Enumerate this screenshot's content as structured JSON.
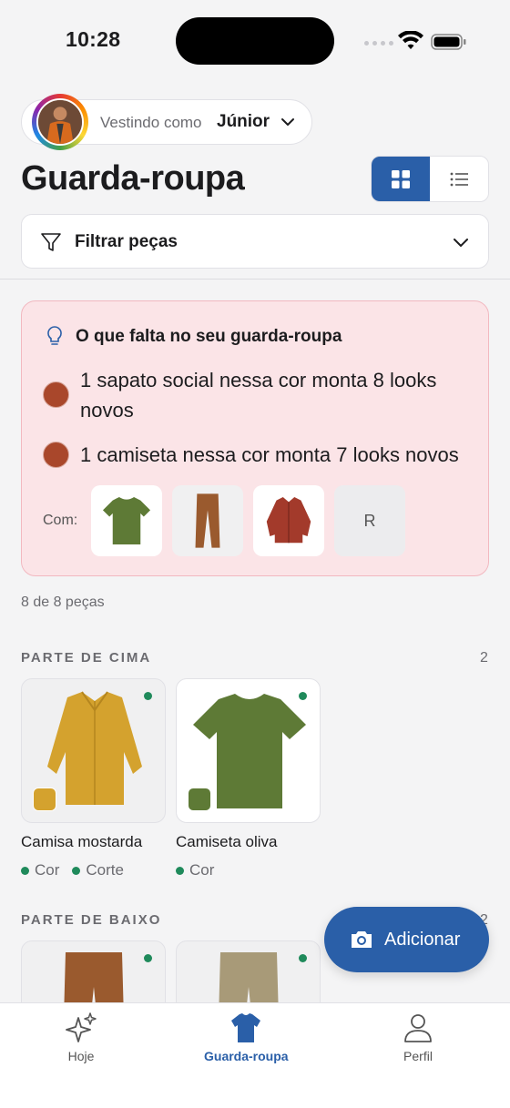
{
  "status_bar": {
    "time": "10:28"
  },
  "person": {
    "caption": "Vestindo como",
    "name": "Júnior"
  },
  "page_title": "Guarda-roupa",
  "filter": {
    "label": "Filtrar peças"
  },
  "gap_card": {
    "title": "O que falta no seu guarda-roupa",
    "items": [
      {
        "text": "1 sapato social nessa cor monta 8 looks novos",
        "swatch_color": "#a9472b"
      },
      {
        "text": "1 camiseta nessa cor monta 7 looks novos",
        "swatch_color": "#a9472b"
      }
    ],
    "com_label": "Com:",
    "thumbs": [
      "green-tshirt",
      "brown-pants",
      "red-jacket"
    ],
    "more_label": "R"
  },
  "count_text": "8 de 8 peças",
  "sections": [
    {
      "title": "PARTE DE CIMA",
      "count": "2",
      "items": [
        {
          "name": "Camisa mostarda",
          "tag_color": "#d4a22e",
          "chips": [
            "Cor",
            "Corte"
          ]
        },
        {
          "name": "Camiseta oliva",
          "tag_color": "#5e7a36",
          "chips": [
            "Cor"
          ]
        }
      ]
    },
    {
      "title": "PARTE DE BAIXO",
      "count": "2",
      "items": [
        {
          "name": "",
          "tag_color": "#9a5a2e"
        },
        {
          "name": "",
          "tag_color": "#a89a78"
        }
      ]
    }
  ],
  "fab": {
    "label": "Adicionar"
  },
  "tabs": [
    {
      "label": "Hoje",
      "icon": "sparkles-icon"
    },
    {
      "label": "Guarda-roupa",
      "icon": "tshirt-icon",
      "active": true
    },
    {
      "label": "Perfil",
      "icon": "person-icon"
    }
  ],
  "colors": {
    "accent": "#2a5fa8",
    "status_green": "#1f8a5b",
    "card_pink": "#fbe4e7"
  }
}
